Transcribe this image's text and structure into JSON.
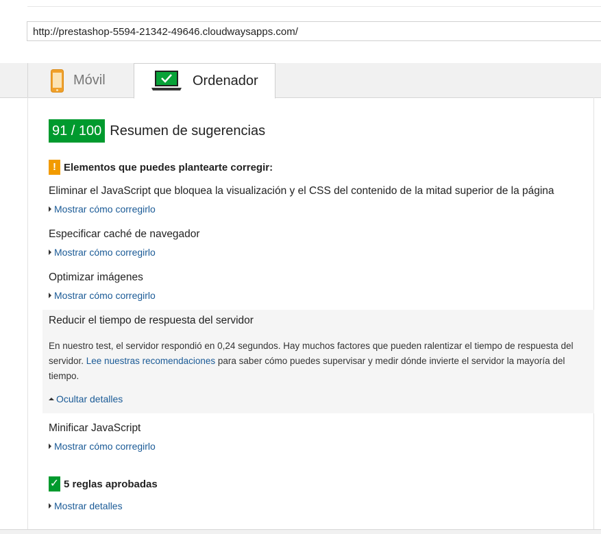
{
  "url": "http://prestashop-5594-21342-49646.cloudwaysapps.com/",
  "tabs": [
    {
      "label": "Móvil",
      "icon": "mobile-phone-icon"
    },
    {
      "label": "Ordenador",
      "icon": "desktop-laptop-icon"
    }
  ],
  "score": {
    "value": "91 / 100",
    "title": "Resumen de sugerencias",
    "color": "#009a2e"
  },
  "warnings": {
    "heading": "Elementos que puedes plantearte corregir:",
    "icon": "!",
    "items": [
      {
        "title": "Eliminar el JavaScript que bloquea la visualización y el CSS del contenido de la mitad superior de la página",
        "link": "Mostrar cómo corregirlo"
      },
      {
        "title": "Especificar caché de navegador",
        "link": "Mostrar cómo corregirlo"
      },
      {
        "title": "Optimizar imágenes",
        "link": "Mostrar cómo corregirlo"
      },
      {
        "title": "Reducir el tiempo de respuesta del servidor",
        "link": "Ocultar detalles"
      },
      {
        "title": "Minificar JavaScript",
        "link": "Mostrar cómo corregirlo"
      }
    ],
    "detail": {
      "part1": "En nuestro test, el servidor respondió en 0,24 segundos. Hay muchos factores que pueden ralentizar el tiempo de respuesta del servidor. ",
      "link": "Lee nuestras recomendaciones",
      "part2": " para saber cómo puedes supervisar y medir dónde invierte el servidor la mayoría del tiempo."
    }
  },
  "passed": {
    "heading": "5 reglas aprobadas",
    "icon": "✓",
    "link": "Mostrar detalles"
  },
  "colors": {
    "warning": "#f29b00",
    "success": "#009a2e",
    "link": "#1a5a96"
  }
}
